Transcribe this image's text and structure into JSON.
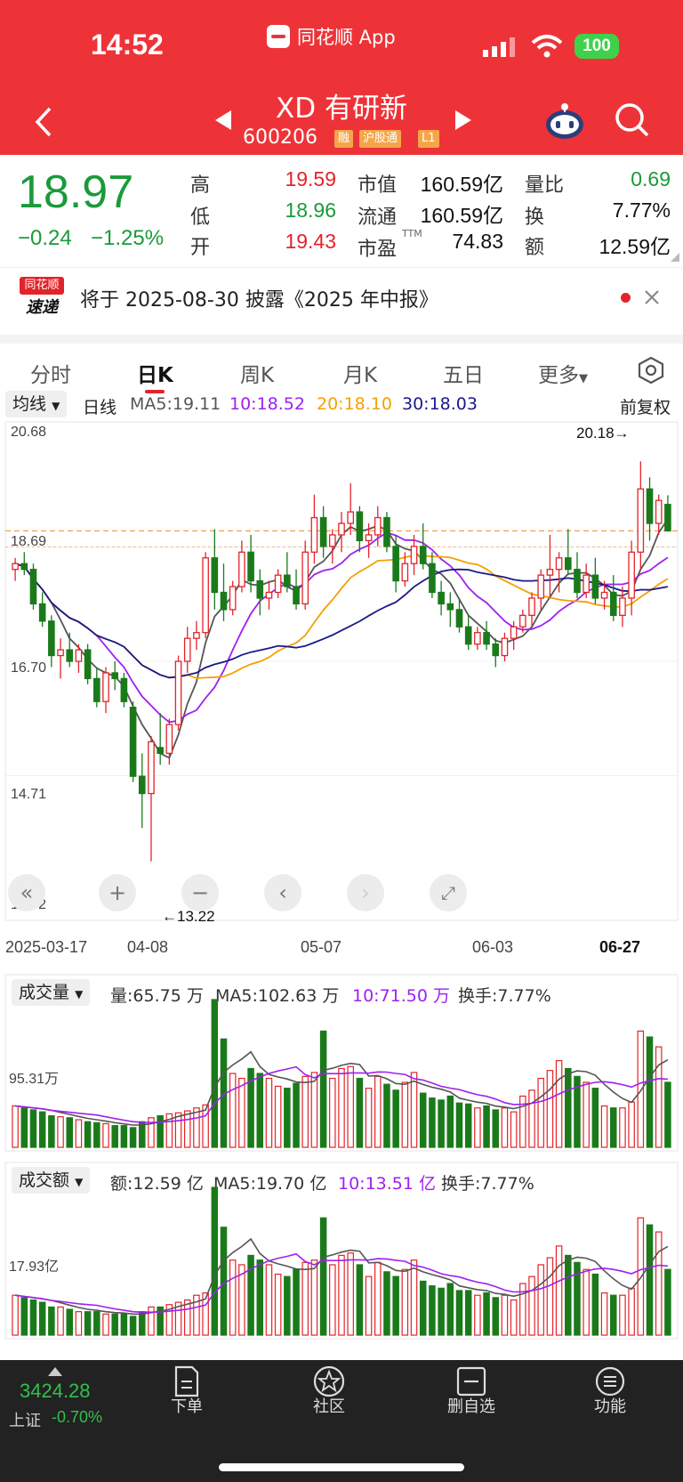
{
  "status_bar": {
    "time": "14:52",
    "app": "同花顺 App",
    "battery": "100"
  },
  "header": {
    "title": "XD 有研新",
    "code": "600206",
    "tags": [
      "融",
      "沪股通",
      "L1"
    ]
  },
  "quote": {
    "price": "18.97",
    "change": "−0.24",
    "change_pct": "−1.25%",
    "high_label": "高",
    "high": "19.59",
    "low_label": "低",
    "low": "18.96",
    "open_label": "开",
    "open": "19.43",
    "mcap_label": "市值",
    "mcap": "160.59亿",
    "float_label": "流通",
    "float": "160.59亿",
    "pe_label": "市盈",
    "pe_sup": "TTM",
    "pe": "74.83",
    "vr_label": "量比",
    "vr": "0.69",
    "turn_label": "换",
    "turn": "7.77%",
    "amt_label": "额",
    "amt": "12.59亿"
  },
  "notice": {
    "logo_top": "同花顺",
    "logo_bottom": "速递",
    "text": "将于 2025-08-30 披露《2025 年中报》"
  },
  "tabs": [
    "分时",
    "日K",
    "周K",
    "月K",
    "五日",
    "更多"
  ],
  "kline": {
    "indicator": "均线",
    "period": "日线",
    "ma5": "MA5:19.11",
    "ma10": "10:18.52",
    "ma20": "20:18.10",
    "ma30": "30:18.03",
    "adjust": "前复权",
    "y_ticks": [
      "20.68",
      "18.69",
      "16.70",
      "14.71",
      "12.72"
    ],
    "high_note": "20.18→",
    "low_note": "←13.22",
    "x_ticks": [
      "2025-03-17",
      "04-08",
      "05-07",
      "06-03",
      "06-27"
    ]
  },
  "volume": {
    "label": "成交量",
    "vol": "量:65.75 万",
    "ma5": "MA5:102.63 万",
    "ma10": "10:71.50 万",
    "turn": "换手:7.77%",
    "y_tick": "95.31万"
  },
  "amount": {
    "label": "成交额",
    "amt": "额:12.59 亿",
    "ma5": "MA5:19.70 亿",
    "ma10": "10:13.51 亿",
    "turn": "换手:7.77%",
    "y_tick": "17.93亿"
  },
  "bottom": {
    "index_value": "3424.28",
    "index_name": "上证",
    "index_change": "-0.70%",
    "items": [
      "下单",
      "社区",
      "删自选",
      "功能"
    ]
  },
  "colors": {
    "header": "#ee3338",
    "up": "#e3232a",
    "down": "#1a7a1a",
    "ma5": "#555555",
    "ma10": "#a020f0",
    "ma20": "#f5a000",
    "ma30": "#1a1a8a"
  },
  "chart_data": {
    "type": "candlestick",
    "ylim": [
      12.72,
      20.68
    ],
    "candles": [
      [
        18.3,
        18.5,
        18.1,
        18.4
      ],
      [
        18.4,
        18.6,
        18.2,
        18.3
      ],
      [
        18.3,
        18.4,
        17.6,
        17.7
      ],
      [
        17.7,
        17.9,
        17.3,
        17.4
      ],
      [
        17.4,
        17.5,
        16.6,
        16.8
      ],
      [
        16.8,
        17.1,
        16.4,
        16.9
      ],
      [
        16.9,
        17.2,
        16.6,
        16.7
      ],
      [
        16.7,
        17.0,
        16.5,
        16.9
      ],
      [
        16.9,
        17.0,
        16.3,
        16.4
      ],
      [
        16.4,
        16.6,
        15.9,
        16.0
      ],
      [
        16.0,
        16.6,
        15.8,
        16.5
      ],
      [
        16.5,
        16.7,
        16.2,
        16.4
      ],
      [
        16.4,
        16.5,
        15.9,
        16.0
      ],
      [
        15.9,
        16.0,
        14.6,
        14.7
      ],
      [
        14.7,
        15.1,
        13.8,
        14.4
      ],
      [
        14.4,
        15.4,
        13.22,
        15.3
      ],
      [
        15.2,
        15.8,
        14.9,
        15.1
      ],
      [
        15.1,
        15.7,
        14.9,
        15.6
      ],
      [
        15.6,
        16.8,
        15.5,
        16.7
      ],
      [
        16.7,
        17.3,
        16.5,
        17.1
      ],
      [
        17.1,
        17.4,
        16.9,
        17.2
      ],
      [
        17.2,
        18.6,
        17.1,
        18.5
      ],
      [
        18.5,
        19.0,
        17.6,
        17.9
      ],
      [
        17.9,
        18.4,
        17.4,
        17.6
      ],
      [
        17.6,
        18.1,
        17.5,
        18.0
      ],
      [
        18.0,
        18.8,
        17.9,
        18.6
      ],
      [
        18.6,
        18.9,
        17.9,
        18.1
      ],
      [
        18.1,
        18.3,
        17.5,
        17.8
      ],
      [
        17.8,
        18.1,
        17.6,
        17.9
      ],
      [
        17.9,
        18.3,
        17.8,
        18.2
      ],
      [
        18.2,
        18.6,
        17.9,
        18.0
      ],
      [
        18.0,
        18.3,
        17.6,
        17.7
      ],
      [
        17.7,
        18.8,
        17.6,
        18.6
      ],
      [
        18.6,
        19.6,
        18.4,
        19.2
      ],
      [
        19.2,
        19.4,
        18.5,
        18.7
      ],
      [
        18.7,
        19.0,
        18.4,
        18.9
      ],
      [
        18.9,
        19.3,
        18.6,
        19.1
      ],
      [
        19.1,
        19.8,
        18.9,
        19.3
      ],
      [
        19.3,
        19.4,
        18.6,
        18.8
      ],
      [
        18.8,
        19.1,
        18.5,
        18.9
      ],
      [
        18.9,
        19.4,
        18.7,
        19.2
      ],
      [
        19.2,
        19.3,
        18.6,
        18.7
      ],
      [
        18.7,
        18.9,
        17.9,
        18.1
      ],
      [
        18.1,
        18.6,
        18.0,
        18.4
      ],
      [
        18.4,
        18.9,
        18.2,
        18.7
      ],
      [
        18.7,
        19.1,
        18.3,
        18.4
      ],
      [
        18.4,
        18.6,
        17.8,
        17.9
      ],
      [
        17.9,
        18.1,
        17.5,
        17.7
      ],
      [
        17.7,
        17.9,
        17.3,
        17.6
      ],
      [
        17.6,
        17.8,
        17.2,
        17.3
      ],
      [
        17.3,
        17.5,
        16.9,
        17.0
      ],
      [
        17.0,
        17.3,
        16.9,
        17.2
      ],
      [
        17.2,
        17.4,
        16.9,
        17.0
      ],
      [
        17.0,
        17.1,
        16.6,
        16.8
      ],
      [
        16.8,
        17.2,
        16.7,
        17.1
      ],
      [
        17.1,
        17.4,
        16.9,
        17.3
      ],
      [
        17.3,
        17.6,
        17.2,
        17.5
      ],
      [
        17.5,
        17.9,
        17.3,
        17.8
      ],
      [
        17.8,
        18.3,
        17.6,
        18.2
      ],
      [
        18.2,
        18.9,
        17.8,
        18.3
      ],
      [
        18.3,
        18.6,
        17.9,
        18.5
      ],
      [
        18.5,
        19.0,
        18.2,
        18.3
      ],
      [
        18.3,
        18.6,
        17.8,
        17.9
      ],
      [
        17.9,
        18.4,
        17.8,
        18.2
      ],
      [
        18.2,
        18.5,
        17.7,
        17.8
      ],
      [
        17.8,
        18.1,
        17.6,
        17.9
      ],
      [
        17.9,
        18.2,
        17.4,
        17.5
      ],
      [
        17.5,
        18.0,
        17.3,
        17.8
      ],
      [
        17.8,
        18.8,
        17.5,
        18.6
      ],
      [
        18.6,
        20.18,
        18.3,
        19.7
      ],
      [
        19.7,
        19.9,
        18.8,
        19.1
      ],
      [
        19.1,
        19.6,
        18.9,
        19.5
      ],
      [
        19.43,
        19.59,
        18.96,
        18.97
      ]
    ],
    "volume_series": [
      42,
      40,
      38,
      36,
      32,
      31,
      30,
      28,
      26,
      25,
      24,
      22,
      22,
      20,
      26,
      30,
      32,
      34,
      35,
      37,
      40,
      43,
      150,
      110,
      75,
      70,
      80,
      75,
      70,
      62,
      60,
      65,
      72,
      76,
      118,
      70,
      80,
      82,
      70,
      60,
      72,
      64,
      58,
      66,
      76,
      55,
      50,
      48,
      52,
      45,
      44,
      40,
      42,
      38,
      40,
      36,
      52,
      58,
      70,
      78,
      88,
      80,
      72,
      66,
      60,
      42,
      40,
      40,
      46,
      118,
      112,
      102,
      66
    ],
    "amount_series": [
      17,
      16,
      15,
      14,
      12,
      12,
      11,
      10,
      10,
      10,
      9,
      9,
      9,
      8,
      10,
      12,
      12,
      13,
      14,
      15,
      17,
      18,
      63,
      46,
      32,
      30,
      34,
      32,
      30,
      26,
      25,
      28,
      31,
      32,
      50,
      30,
      34,
      35,
      30,
      25,
      31,
      27,
      25,
      28,
      32,
      23,
      21,
      20,
      22,
      19,
      19,
      17,
      18,
      16,
      17,
      15,
      22,
      25,
      30,
      33,
      38,
      34,
      31,
      28,
      26,
      18,
      17,
      17,
      20,
      50,
      47,
      44,
      28
    ]
  }
}
